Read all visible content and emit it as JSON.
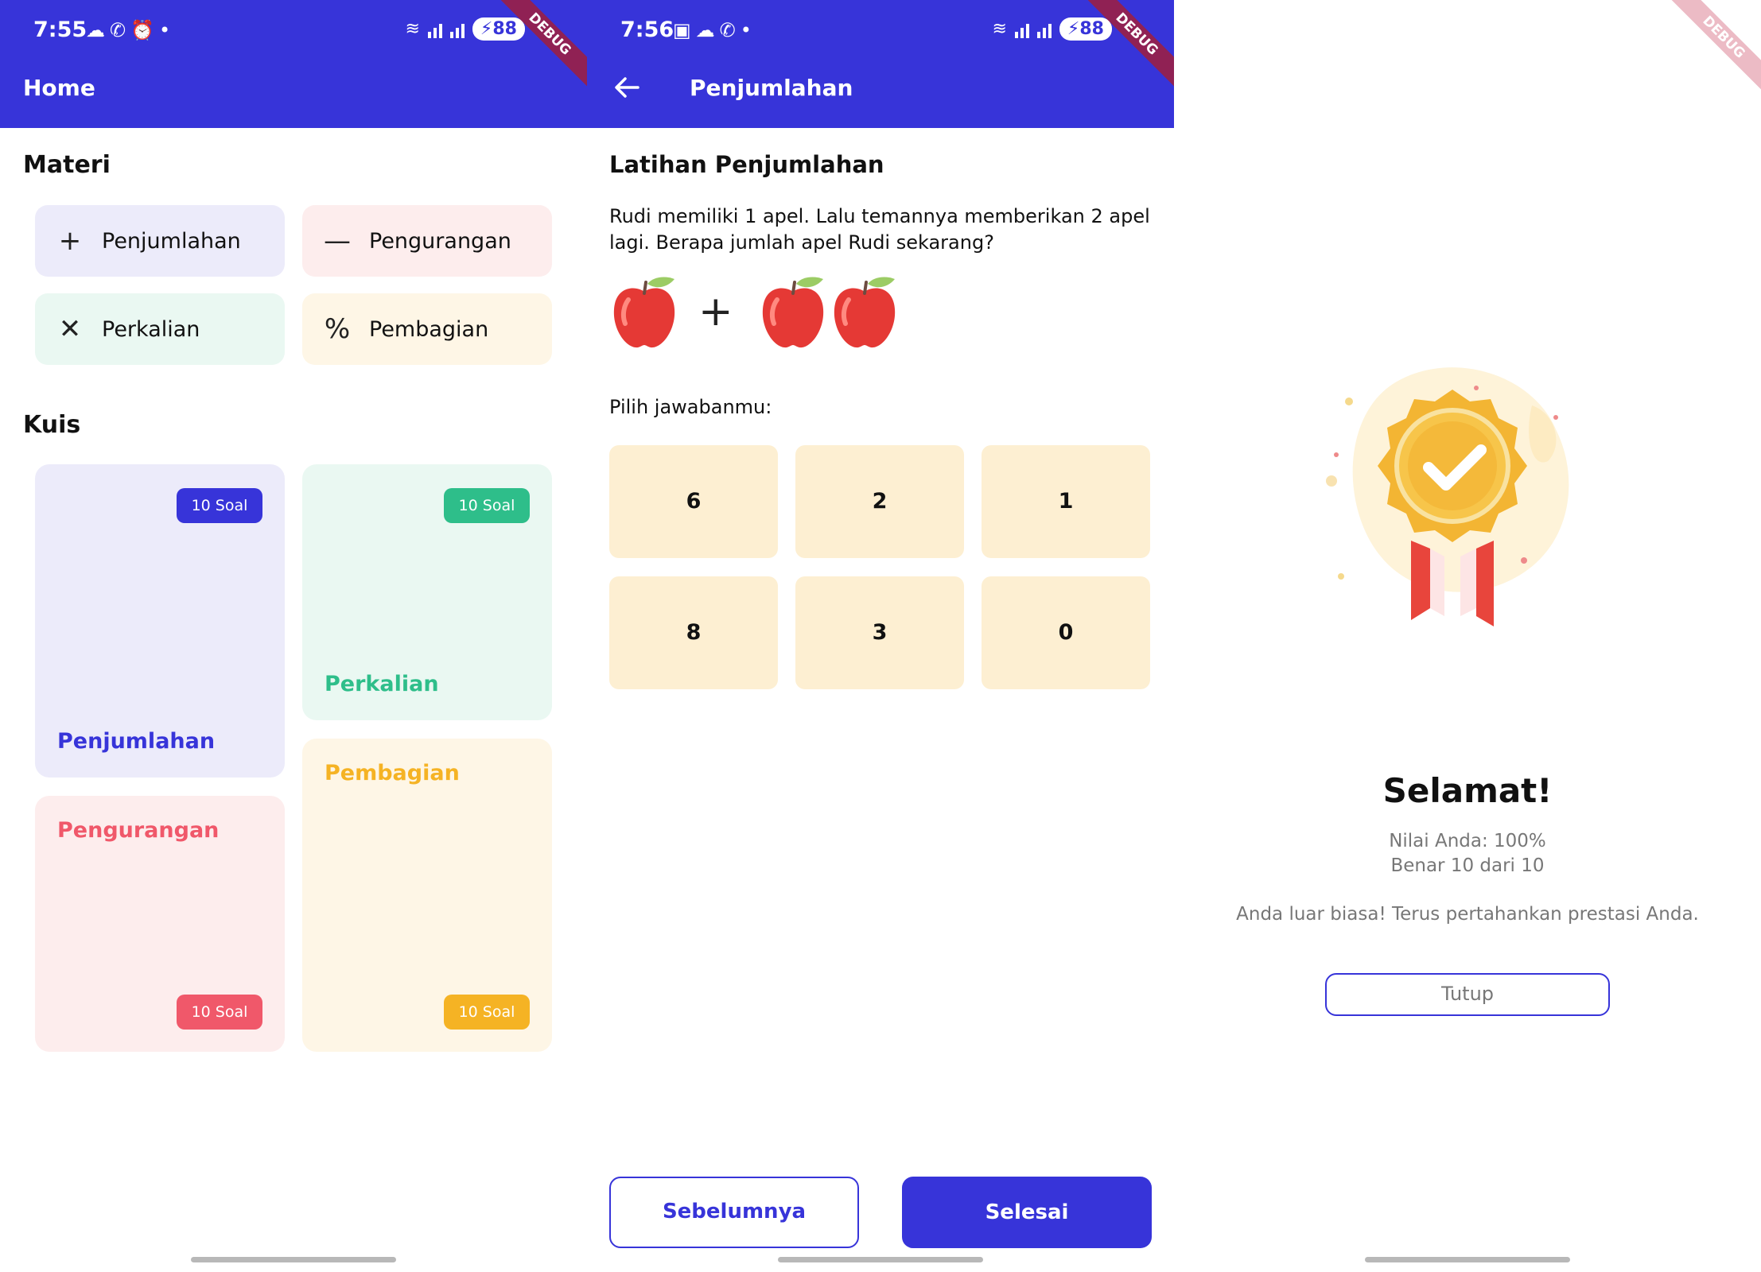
{
  "home": {
    "status": {
      "time": "7:55",
      "battery": "88"
    },
    "title": "Home",
    "debug_label": "DEBUG",
    "materi_heading": "Materi",
    "materi": [
      {
        "label": "Penjumlahan",
        "icon": "plus-icon",
        "bg": "#ECEBFA"
      },
      {
        "label": "Pengurangan",
        "icon": "minus-icon",
        "bg": "#FDEDED"
      },
      {
        "label": "Perkalian",
        "icon": "times-icon",
        "bg": "#EAF8F2"
      },
      {
        "label": "Pembagian",
        "icon": "percent-icon",
        "bg": "#FEF6E6"
      }
    ],
    "kuis_heading": "Kuis",
    "kuis": [
      {
        "title": "Penjumlahan",
        "badge": "10 Soal",
        "accent": "#3734D9",
        "bg": "#ECEBFA"
      },
      {
        "title": "Perkalian",
        "badge": "10 Soal",
        "accent": "#2EBE8A",
        "bg": "#EAF8F2"
      },
      {
        "title": "Pengurangan",
        "badge": "10 Soal",
        "accent": "#F0586A",
        "bg": "#FDEDED"
      },
      {
        "title": "Pembagian",
        "badge": "10 Soal",
        "accent": "#F5B324",
        "bg": "#FEF6E6"
      }
    ]
  },
  "latihan": {
    "status": {
      "time": "7:56",
      "battery": "88"
    },
    "title": "Penjumlahan",
    "debug_label": "DEBUG",
    "heading": "Latihan Penjumlahan",
    "question": "Rudi memiliki 1 apel. Lalu temannya memberikan 2 apel lagi. Berapa jumlah apel Rudi sekarang?",
    "prompt": "Pilih jawabanmu:",
    "options": [
      "6",
      "2",
      "1",
      "8",
      "3",
      "0"
    ],
    "prev_label": "Sebelumnya",
    "next_label": "Selesai",
    "primary_color": "#3734D9"
  },
  "result": {
    "debug_label": "DEBUG",
    "title": "Selamat!",
    "score": "Nilai Anda: 100%",
    "correct": "Benar 10 dari 10",
    "message": "Anda luar biasa! Terus pertahankan prestasi Anda.",
    "close_label": "Tutup"
  }
}
